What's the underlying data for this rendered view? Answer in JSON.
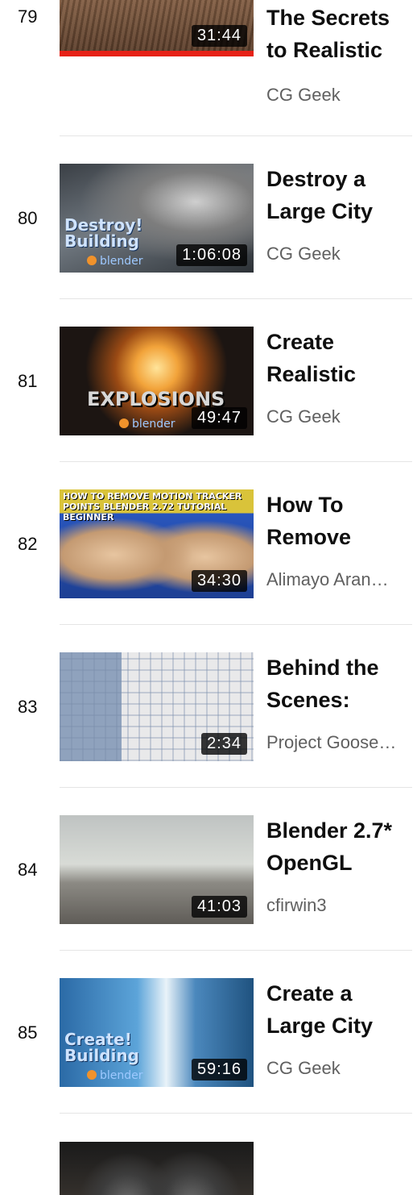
{
  "playlist": {
    "items": [
      {
        "index": "79",
        "duration": "31:44",
        "title": "The Secrets to Realistic",
        "channel": "CG Geek",
        "watched_fraction": 1.0
      },
      {
        "index": "80",
        "duration": "1:06:08",
        "title": "Destroy a Large City",
        "channel": "CG Geek",
        "overlay_text": "Destroy! Building",
        "badge_text": "blender"
      },
      {
        "index": "81",
        "duration": "49:47",
        "title": "Create Realistic",
        "channel": "CG Geek",
        "overlay_text": "EXPLOSIONS",
        "badge_text": "blender"
      },
      {
        "index": "82",
        "duration": "34:30",
        "title": "How To Remove",
        "channel": "Alimayo Aran…",
        "overlay_text": "HOW TO REMOVE MOTION TRACKER POINTS BLENDER 2.72 TUTORIAL BEGINNER"
      },
      {
        "index": "83",
        "duration": "2:34",
        "title": "Behind the Scenes:",
        "channel": "Project Goose…"
      },
      {
        "index": "84",
        "duration": "41:03",
        "title": "Blender 2.7* OpenGL",
        "channel": "cfirwin3"
      },
      {
        "index": "85",
        "duration": "59:16",
        "title": "Create a Large City",
        "channel": "CG Geek",
        "overlay_text": "Create! Building",
        "badge_text": "blender"
      },
      {
        "index": "",
        "duration": "",
        "title": "",
        "channel": ""
      }
    ]
  },
  "colors": {
    "progress_red": "#e62117",
    "channel_gray": "#606060",
    "divider": "#e5e5e5"
  }
}
